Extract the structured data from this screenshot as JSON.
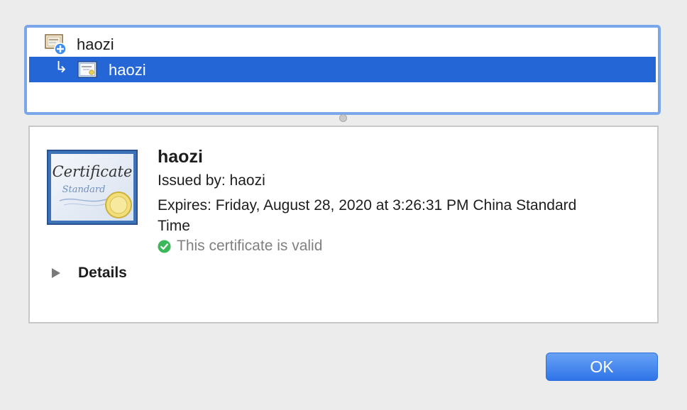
{
  "tree": {
    "root": {
      "label": "haozi",
      "icon": "certificate-authority-icon"
    },
    "child": {
      "label": "haozi",
      "icon": "certificate-icon",
      "arrow": "↳"
    }
  },
  "detail": {
    "name": "haozi",
    "issued_by": "Issued by: haozi",
    "expires": "Expires: Friday, August 28, 2020 at 3:26:31 PM China Standard Time",
    "status": "This certificate is valid",
    "details_label": "Details",
    "cert_title": "Certificate",
    "cert_subtitle": "Standard"
  },
  "buttons": {
    "ok_label": "OK"
  },
  "colors": {
    "selection": "#2466d6",
    "focus_ring": "#7aa7ea",
    "valid_green": "#3cb85a",
    "button_blue": "#2f74e8"
  }
}
